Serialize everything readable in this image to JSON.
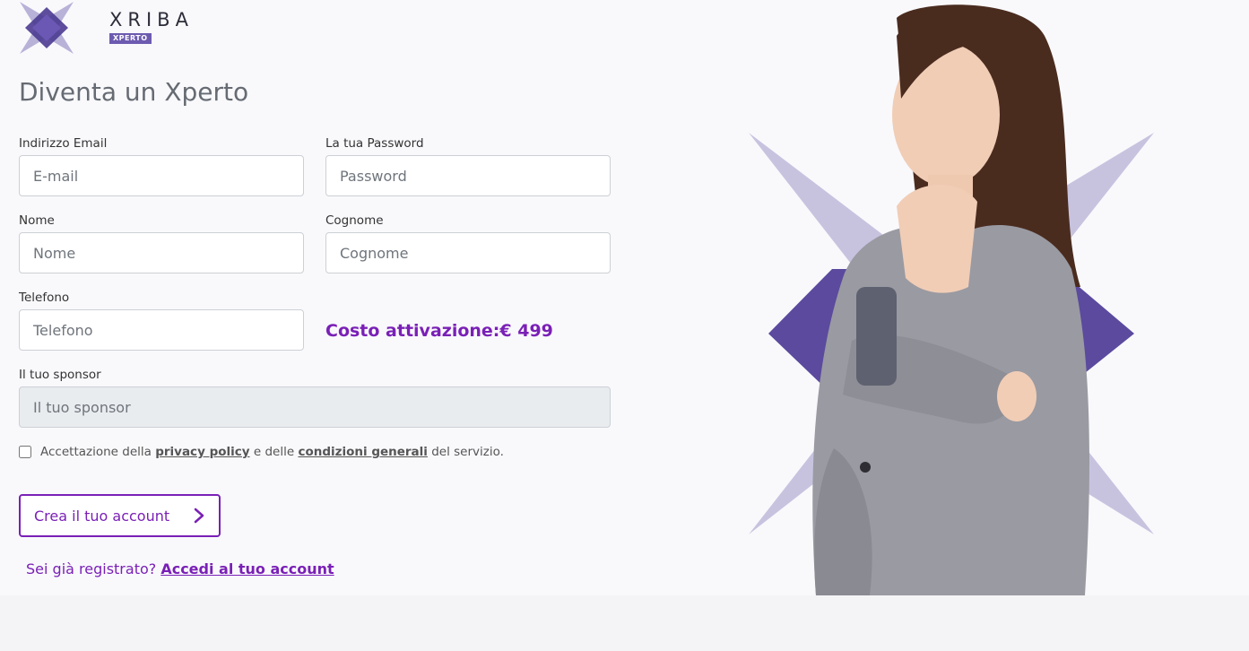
{
  "brand": {
    "name": "XRIBA",
    "badge": "XPERTO"
  },
  "page_title": "Diventa un Xperto",
  "form": {
    "email": {
      "label": "Indirizzo Email",
      "placeholder": "E-mail"
    },
    "password": {
      "label": "La tua Password",
      "placeholder": "Password"
    },
    "first_name": {
      "label": "Nome",
      "placeholder": "Nome"
    },
    "last_name": {
      "label": "Cognome",
      "placeholder": "Cognome"
    },
    "phone": {
      "label": "Telefono",
      "placeholder": "Telefono"
    },
    "sponsor": {
      "label": "Il tuo sponsor",
      "placeholder": "Il tuo sponsor"
    },
    "activation_cost": "Costo attivazione:€ 499",
    "terms": {
      "prefix": "Accettazione della ",
      "privacy_link": "privacy policy",
      "middle": " e delle ",
      "conditions_link": "condizioni generali",
      "suffix": " del servizio."
    },
    "submit_label": "Crea il tuo account",
    "signin_prompt": "Sei già registrato? ",
    "signin_link": "Accedi al tuo account"
  },
  "colors": {
    "accent": "#7a20b6",
    "logo_dark": "#4b3a91",
    "logo_light": "#b8b2d8",
    "star_light": "#c7c3df",
    "star_dark": "#5b4a9e"
  }
}
